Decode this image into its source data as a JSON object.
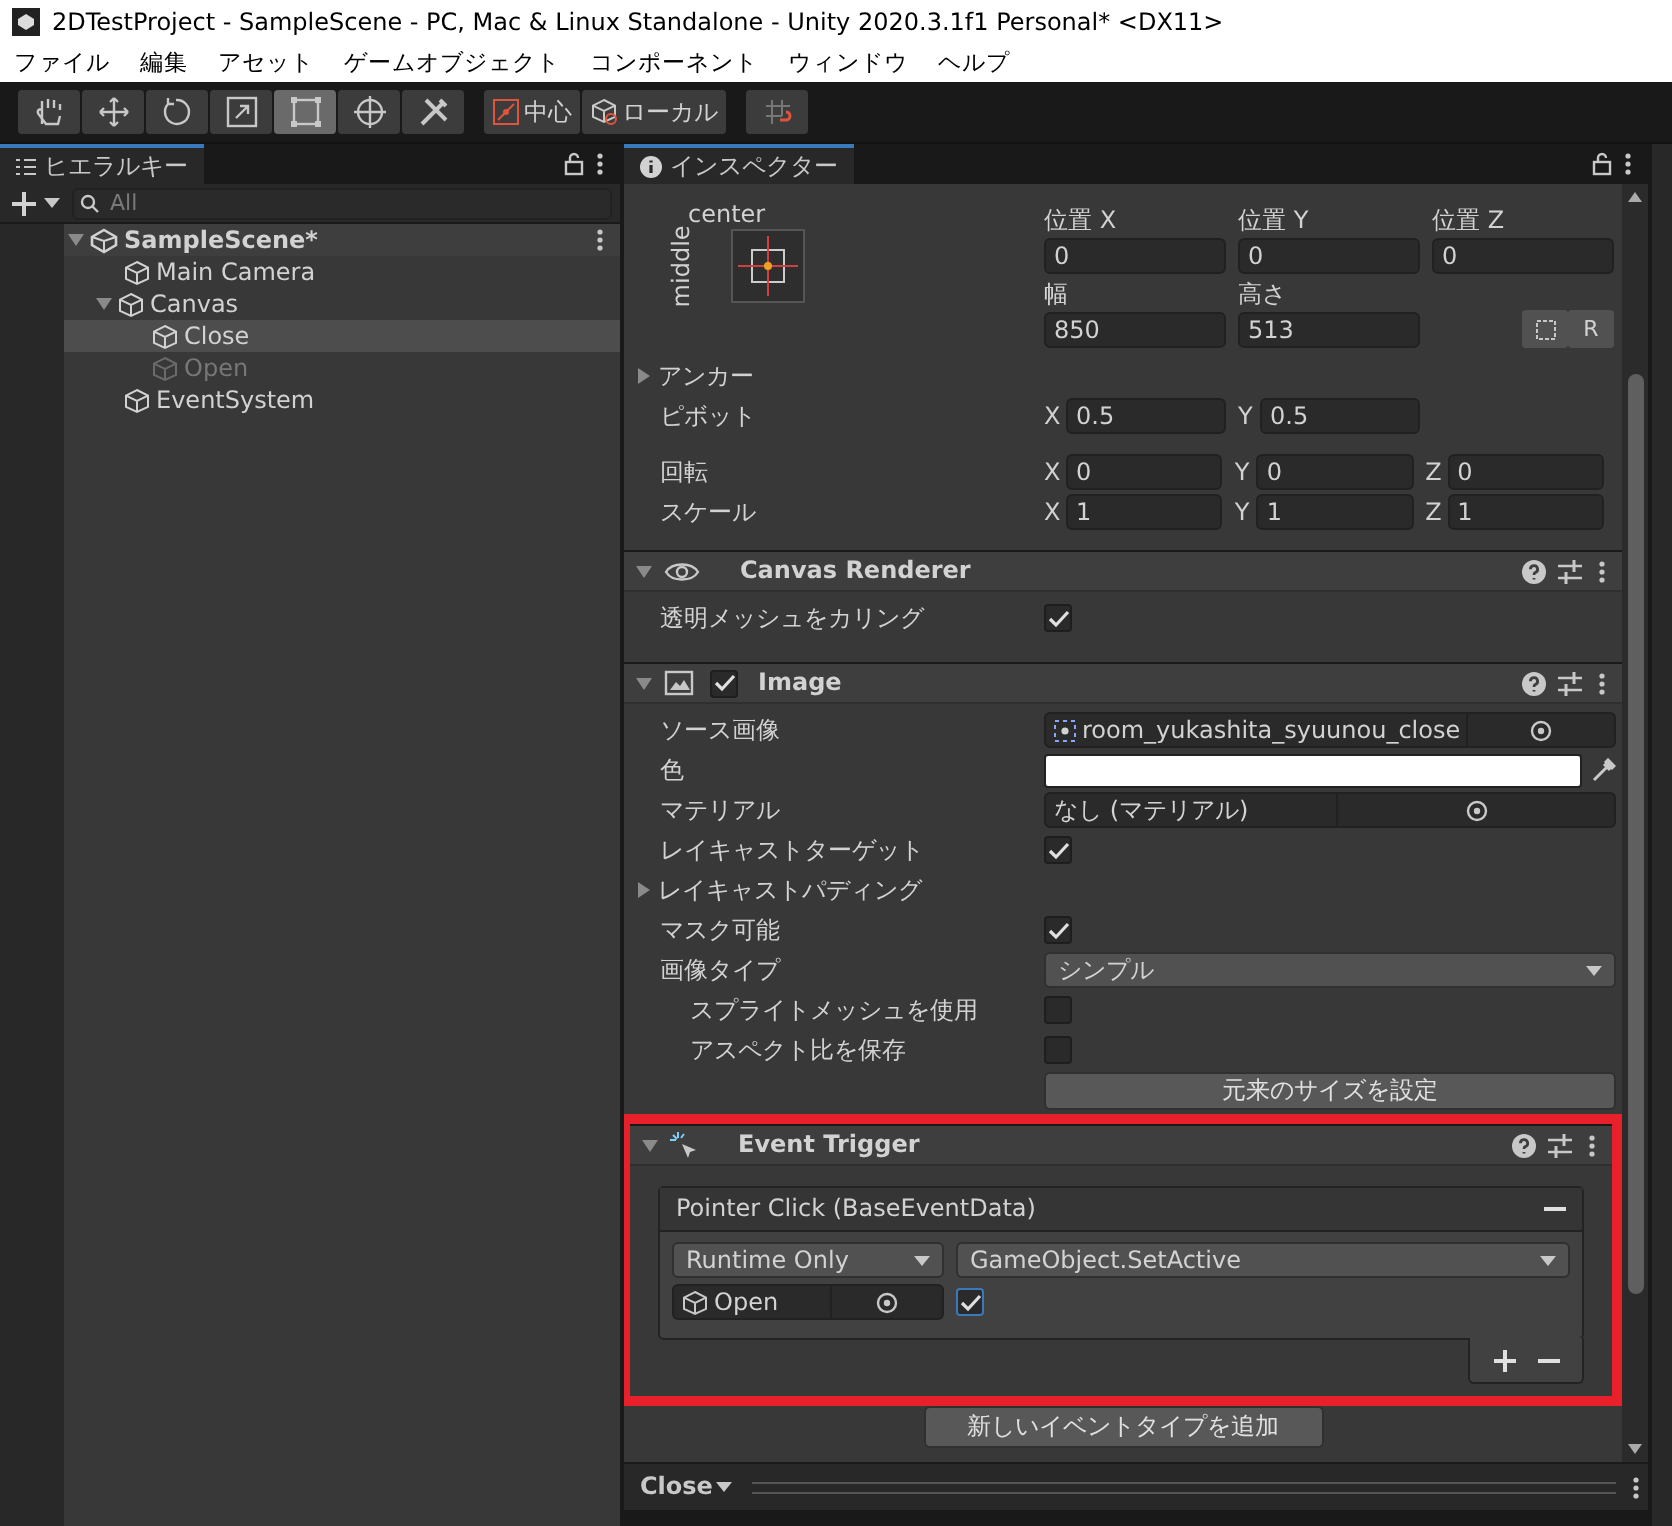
{
  "window": {
    "title": "2DTestProject - SampleScene - PC, Mac & Linux Standalone - Unity 2020.3.1f1 Personal* <DX11>"
  },
  "menu": [
    "ファイル",
    "編集",
    "アセット",
    "ゲームオブジェクト",
    "コンポーネント",
    "ウィンドウ",
    "ヘルプ"
  ],
  "toolbar": {
    "tools": [
      {
        "kind": "hand",
        "selected": false
      },
      {
        "kind": "move",
        "selected": false
      },
      {
        "kind": "rotate",
        "selected": false
      },
      {
        "kind": "scale",
        "selected": false
      },
      {
        "kind": "rect",
        "selected": true
      },
      {
        "kind": "transform",
        "selected": false
      },
      {
        "kind": "custom",
        "selected": false
      }
    ],
    "handle_buttons": [
      {
        "kind": "pivot",
        "label": "中心"
      },
      {
        "kind": "space",
        "label": "ローカル"
      }
    ]
  },
  "hierarchy": {
    "title": "ヒエラルキー",
    "search": {
      "placeholder": "All"
    },
    "tree": [
      {
        "name": "SampleScene*",
        "kind": "scene",
        "expanded": true,
        "selected": false,
        "active": true,
        "children": [
          {
            "name": "Main Camera",
            "kind": "object",
            "selected": false,
            "active": true
          },
          {
            "name": "Canvas",
            "kind": "object",
            "expanded": true,
            "selected": false,
            "active": true,
            "children": [
              {
                "name": "Close",
                "kind": "object",
                "selected": true,
                "active": true
              },
              {
                "name": "Open",
                "kind": "object",
                "selected": false,
                "active": false
              }
            ]
          },
          {
            "name": "EventSystem",
            "kind": "object",
            "selected": false,
            "active": true
          }
        ]
      }
    ]
  },
  "inspector": {
    "title": "インスペクター",
    "rect_transform": {
      "anchor_preset": {
        "horizontal": "center",
        "vertical": "middle"
      },
      "fields": [
        {
          "label": "位置 X",
          "value": "0"
        },
        {
          "label": "位置 Y",
          "value": "0"
        },
        {
          "label": "位置 Z",
          "value": "0"
        },
        {
          "label": "幅",
          "value": "850"
        },
        {
          "label": "高さ",
          "value": "513"
        }
      ],
      "reset_button": "R",
      "rows": [
        {
          "label": "アンカー",
          "kind": "foldout",
          "expanded": false
        },
        {
          "label": "ピボット",
          "kind": "vector",
          "fields": [
            {
              "axis": "X",
              "value": "0.5"
            },
            {
              "axis": "Y",
              "value": "0.5"
            }
          ]
        },
        {
          "label": "回転",
          "kind": "vector",
          "fields": [
            {
              "axis": "X",
              "value": "0"
            },
            {
              "axis": "Y",
              "value": "0"
            },
            {
              "axis": "Z",
              "value": "0"
            }
          ]
        },
        {
          "label": "スケール",
          "kind": "vector",
          "fields": [
            {
              "axis": "X",
              "value": "1"
            },
            {
              "axis": "Y",
              "value": "1"
            },
            {
              "axis": "Z",
              "value": "1"
            }
          ]
        }
      ]
    },
    "components": [
      {
        "kind": "canvas_renderer",
        "title": "Canvas Renderer",
        "expanded": true,
        "highlighted": false,
        "properties": [
          {
            "label": "透明メッシュをカリング",
            "kind": "checkbox",
            "checked": true
          }
        ]
      },
      {
        "kind": "image",
        "title": "Image",
        "expanded": true,
        "enabled": true,
        "highlighted": false,
        "properties": [
          {
            "label": "ソース画像",
            "kind": "object",
            "asset_icon": true,
            "value": "room_yukashita_syuunou_close"
          },
          {
            "label": "色",
            "kind": "color",
            "color": "#ffffff"
          },
          {
            "label": "マテリアル",
            "kind": "object",
            "value": "なし (マテリアル)"
          },
          {
            "label": "レイキャストターゲット",
            "kind": "checkbox",
            "checked": true
          },
          {
            "label": "レイキャストパディング",
            "kind": "foldout",
            "expanded": false
          },
          {
            "label": "マスク可能",
            "kind": "checkbox",
            "checked": true
          },
          {
            "label": "画像タイプ",
            "kind": "dropdown",
            "value": "シンプル",
            "children": [
              {
                "label": "スプライトメッシュを使用",
                "kind": "checkbox",
                "checked": false
              },
              {
                "label": "アスペクト比を保存",
                "kind": "checkbox",
                "checked": false
              }
            ]
          },
          {
            "kind": "button",
            "text": "元来のサイズを設定"
          }
        ]
      },
      {
        "kind": "event_trigger",
        "title": "Event Trigger",
        "expanded": true,
        "highlighted": true,
        "entries": [
          {
            "title": "Pointer Click (BaseEventData)",
            "calls": [
              {
                "mode": "Runtime Only",
                "function": "GameObject.SetActive",
                "target": "Open",
                "argument_checked": true
              }
            ]
          }
        ],
        "add_button": "新しいイベントタイプを追加"
      }
    ]
  },
  "footer": {
    "object_name": "Close"
  }
}
